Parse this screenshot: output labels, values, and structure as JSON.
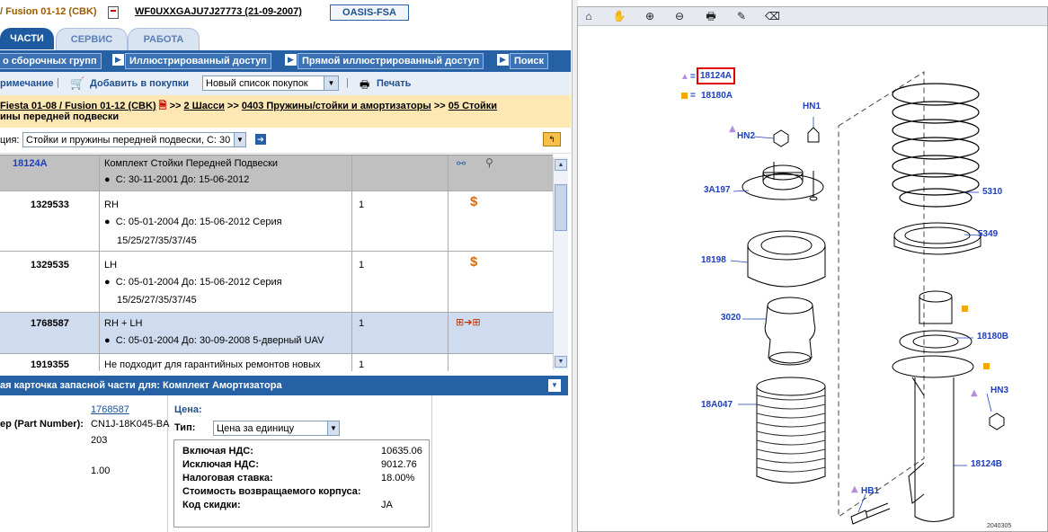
{
  "header": {
    "model": "/ Fusion 01-12 (CBK)",
    "vin": "WF0UXXGAJU7J27773 (21-09-2007)",
    "badge": "OASIS-FSA"
  },
  "tabs": [
    {
      "label": "ЧАСТИ",
      "active": true
    },
    {
      "label": "СЕРВИС",
      "active": false
    },
    {
      "label": "РАБОТА",
      "active": false
    }
  ],
  "access": {
    "groups": "о сборочных групп",
    "illustrated": "Иллюстрированный доступ",
    "direct": "Прямой иллюстрированный доступ",
    "search": "Поиск"
  },
  "toolbar": {
    "note": "римечание",
    "add_to_cart": "Добавить в покупки",
    "list_select": "Новый список покупок",
    "print": "Печать"
  },
  "breadcrumb": {
    "line1": [
      "Fiesta 01-08 / Fusion 01-12 (CBK)",
      "2 Шасси",
      "0403 Пружины/стойки и амортизаторы",
      "05 Стойки"
    ],
    "separator": ">>",
    "line2": "ины передней подвески"
  },
  "refrow": {
    "label": "ция:",
    "select": "Стойки и пружины передней подвески, С: 30"
  },
  "parts": [
    {
      "num": "18124A",
      "desc": "Комплект Стойки Передней Подвески",
      "detail": "С: 30-11-2001 До: 15-06-2012",
      "detail2": "",
      "qty": "",
      "state": "header"
    },
    {
      "num": "1329533",
      "desc": "RH",
      "detail": "С: 05-01-2004 До: 15-06-2012 Серия",
      "detail2": "15/25/27/35/37/45",
      "qty": "1",
      "state": "price"
    },
    {
      "num": "1329535",
      "desc": "LH",
      "detail": "С: 05-01-2004 До: 15-06-2012 Серия",
      "detail2": "15/25/27/35/37/45",
      "qty": "1",
      "state": "price"
    },
    {
      "num": "1768587",
      "desc": "RH + LH",
      "detail": "С: 05-01-2004 До: 30-09-2008 5-дверный UAV",
      "detail2": "",
      "qty": "1",
      "state": "selected"
    },
    {
      "num": "1919355",
      "desc": "Не подходит для гарантийных ремонтов новых",
      "detail": "",
      "detail2": "",
      "qty": "1",
      "state": "normal"
    }
  ],
  "card": {
    "title": "ая карточка запасной части для: Комплект Амортизатора",
    "part_number_label": "ер (Part Number):",
    "link": "1768587",
    "part_code": "CN1J-18K045-BA",
    "part_code2": "203",
    "qty_value": "1.00",
    "price_label": "Цена:",
    "type_label": "Тип:",
    "type_value": "Цена за единицу",
    "incl_vat_label": "Включая НДС:",
    "incl_vat": "10635.06",
    "excl_vat_label": "Исключая НДС:",
    "excl_vat": "9012.76",
    "tax_label": "Налоговая ставка:",
    "tax": "18.00%",
    "core_label": "Стоимость возвращаемого корпуса:",
    "core": "",
    "discount_label": "Код скидки:",
    "discount": "JA"
  },
  "diagram": {
    "legend_triangle": "18124A",
    "legend_square": "18180A",
    "labels": [
      "HN1",
      "HN2",
      "3A197",
      "5310",
      "5349",
      "18198",
      "3020",
      "18180B",
      "HN3",
      "18A047",
      "18124B",
      "HB1"
    ],
    "ref": "2040305",
    "colors": {
      "label": "#1c3fbf",
      "triangle": "#b48ce0",
      "square": "#f5a800",
      "highlight": "#e00000"
    }
  },
  "right_toolbar_icons": [
    "home-icon",
    "hand-icon",
    "zoom-in-icon",
    "zoom-out-icon",
    "print-icon",
    "pencil-icon",
    "eraser-icon"
  ]
}
